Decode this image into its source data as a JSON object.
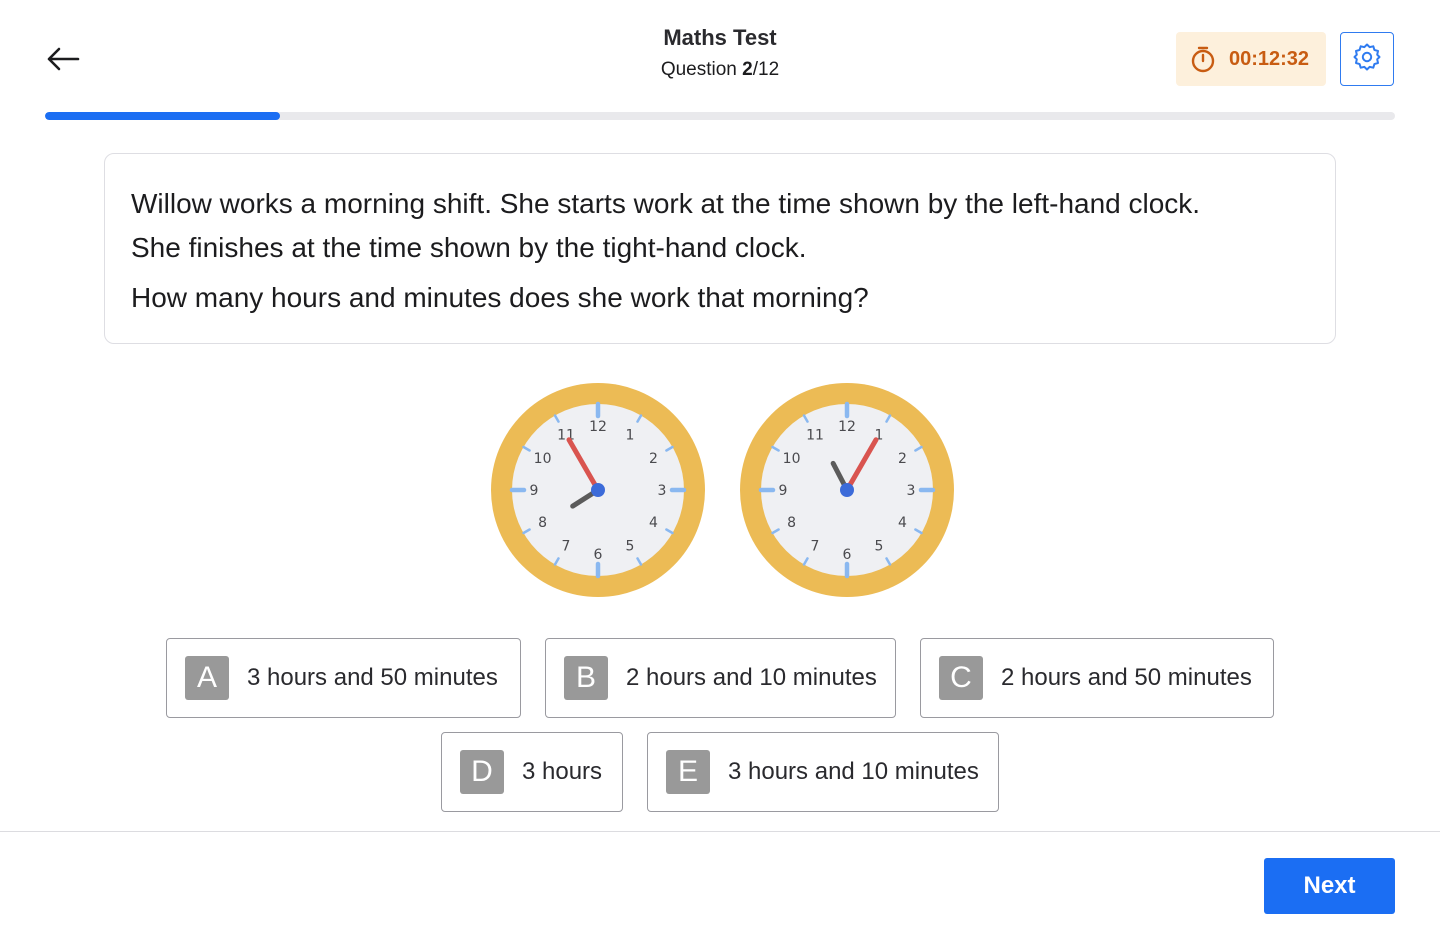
{
  "header": {
    "back_icon": "arrow-left-icon",
    "title": "Maths Test",
    "question_label": "Question",
    "question_current": "2",
    "question_total": "/12",
    "timer": {
      "icon": "stopwatch-icon",
      "value": "00:12:32",
      "color": "#c85c12",
      "background": "#fdf0dc"
    },
    "settings_icon": "gear-icon"
  },
  "progress": {
    "fraction": 0.174,
    "color": "#1b6ef3"
  },
  "question": {
    "line1": "Willow works a morning shift. She starts work at  the time shown by the left-hand clock.",
    "line2": "She finishes at the time shown by the tight-hand clock.",
    "line3": "How many hours and minutes does she work that morning?"
  },
  "clocks": {
    "numbers": [
      "12",
      "1",
      "2",
      "3",
      "4",
      "5",
      "6",
      "7",
      "8",
      "9",
      "10",
      "11"
    ],
    "left": {
      "hours": 7,
      "minutes": 55
    },
    "right": {
      "hours": 11,
      "minutes": 5
    },
    "rim_color": "#ecbb55",
    "face_color": "#eff0f3",
    "minute_hand_color": "#d9544f",
    "hour_hand_color": "#5b5b5b",
    "center_color": "#3c6bd9"
  },
  "answers": [
    {
      "letter": "A",
      "text": "3 hours and 50 minutes"
    },
    {
      "letter": "B",
      "text": "2 hours and 10 minutes"
    },
    {
      "letter": "C",
      "text": "2 hours and 50 minutes"
    },
    {
      "letter": "D",
      "text": "3 hours"
    },
    {
      "letter": "E",
      "text": "3 hours and 10 minutes"
    }
  ],
  "footer": {
    "next_label": "Next",
    "accent": "#1b6ef3"
  }
}
